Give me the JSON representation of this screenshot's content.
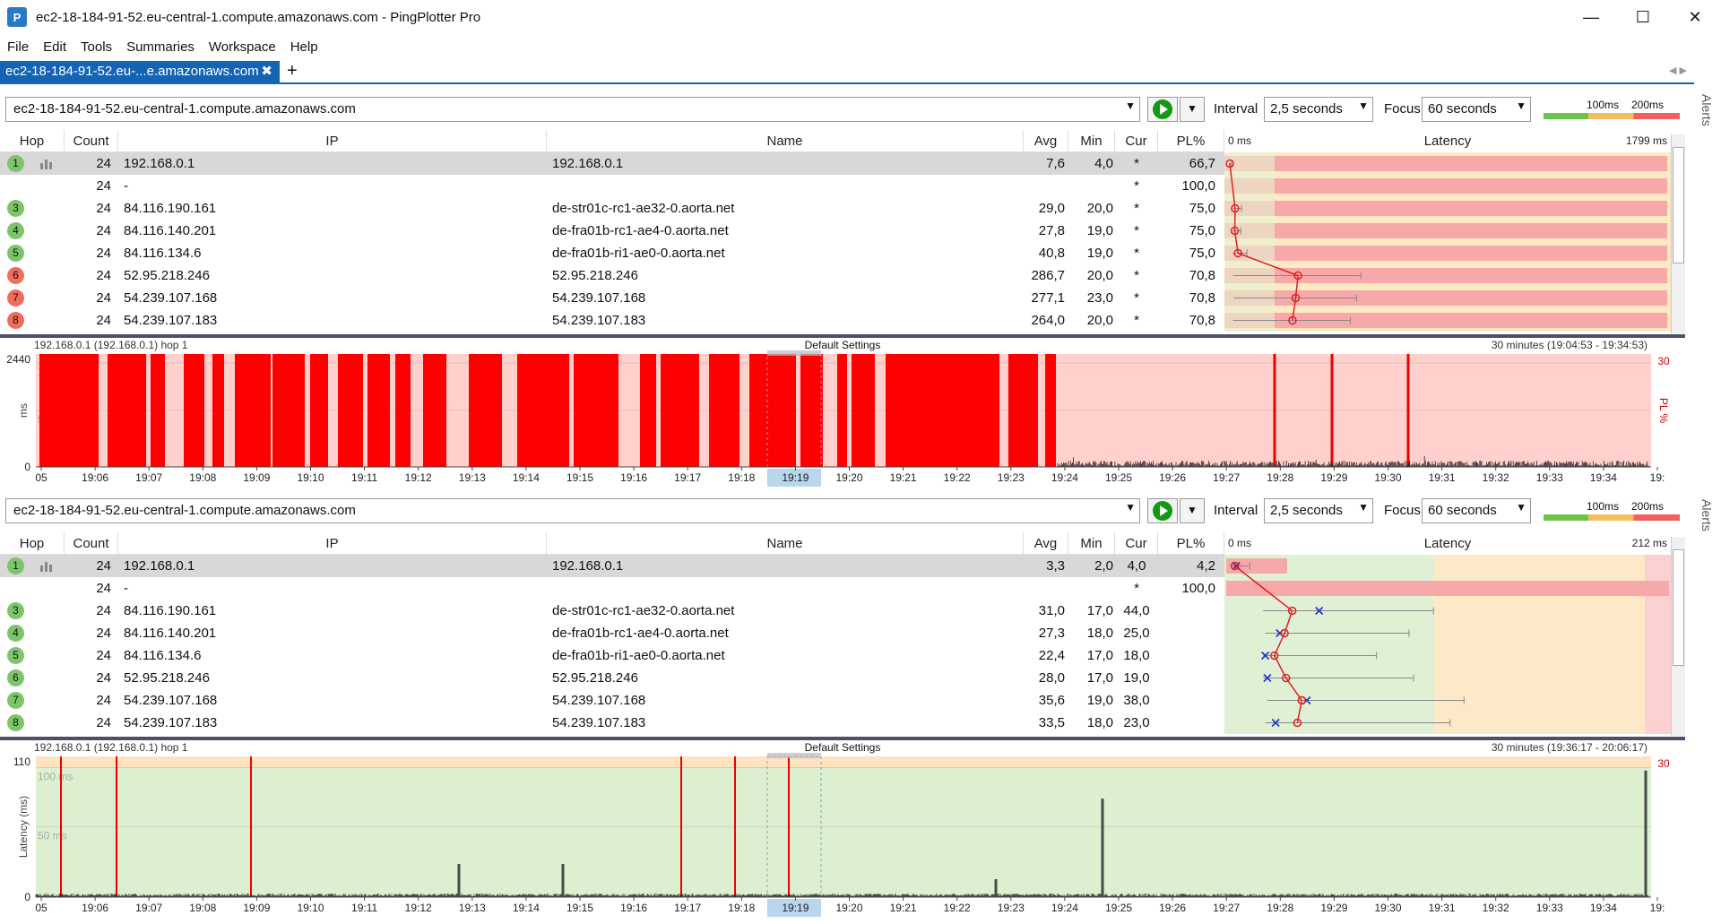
{
  "window": {
    "title": "ec2-18-184-91-52.eu-central-1.compute.amazonaws.com - PingPlotter Pro",
    "icon": "app-logo-icon",
    "minimize": "—",
    "maximize": "☐",
    "close": "✕"
  },
  "menu": [
    "File",
    "Edit",
    "Tools",
    "Summaries",
    "Workspace",
    "Help"
  ],
  "tab": {
    "label": "ec2-18-184-91-52.eu-...e.amazonaws.com",
    "close": "✖",
    "add": "+",
    "nav": "◀  ▶"
  },
  "alerts": "Alerts",
  "columns": {
    "hop": "Hop",
    "count": "Count",
    "ip": "IP",
    "name": "Name",
    "avg": "Avg",
    "min": "Min",
    "cur": "Cur",
    "pl": "PL%",
    "latency": "Latency"
  },
  "panels": [
    {
      "target": "ec2-18-184-91-52.eu-central-1.compute.amazonaws.com",
      "interval_label": "Interval",
      "interval": "2,5 seconds",
      "focus_label": "Focus",
      "focus": "60 seconds",
      "scale_100": "100ms",
      "scale_200": "200ms",
      "lat_min": "0 ms",
      "lat_max": "1799 ms",
      "rows": [
        {
          "hop": "1",
          "status": "green",
          "count": "24",
          "ip": "192.168.0.1",
          "name": "192.168.0.1",
          "avg": "7,6",
          "min": "4,0",
          "cur": "*",
          "pl": "66,7"
        },
        {
          "hop": "",
          "status": "none",
          "count": "24",
          "ip": "-",
          "name": "",
          "avg": "",
          "min": "",
          "cur": "*",
          "pl": "100,0"
        },
        {
          "hop": "3",
          "status": "green",
          "count": "24",
          "ip": "84.116.190.161",
          "name": "de-str01c-rc1-ae32-0.aorta.net",
          "avg": "29,0",
          "min": "20,0",
          "cur": "*",
          "pl": "75,0"
        },
        {
          "hop": "4",
          "status": "green",
          "count": "24",
          "ip": "84.116.140.201",
          "name": "de-fra01b-rc1-ae4-0.aorta.net",
          "avg": "27,8",
          "min": "19,0",
          "cur": "*",
          "pl": "75,0"
        },
        {
          "hop": "5",
          "status": "green",
          "count": "24",
          "ip": "84.116.134.6",
          "name": "de-fra01b-ri1-ae0-0.aorta.net",
          "avg": "40,8",
          "min": "19,0",
          "cur": "*",
          "pl": "75,0"
        },
        {
          "hop": "6",
          "status": "red",
          "count": "24",
          "ip": "52.95.218.246",
          "name": "52.95.218.246",
          "avg": "286,7",
          "min": "20,0",
          "cur": "*",
          "pl": "70,8"
        },
        {
          "hop": "7",
          "status": "red",
          "count": "24",
          "ip": "54.239.107.168",
          "name": "54.239.107.168",
          "avg": "277,1",
          "min": "23,0",
          "cur": "*",
          "pl": "70,8"
        },
        {
          "hop": "8",
          "status": "red",
          "count": "24",
          "ip": "54.239.107.183",
          "name": "54.239.107.183",
          "avg": "264,0",
          "min": "20,0",
          "cur": "*",
          "pl": "70,8"
        }
      ],
      "graph": {
        "header": "192.168.0.1 (192.168.0.1) hop 1",
        "center": "Default Settings",
        "range": "30 minutes (19:04:53 - 19:34:53)",
        "ymax": "2440",
        "ymin": "0",
        "yunit": "ms",
        "pl_label": "PL %",
        "pl_max": "30",
        "grid1": "1000 ms",
        "grid2": "500 ms"
      }
    },
    {
      "target": "ec2-18-184-91-52.eu-central-1.compute.amazonaws.com",
      "interval_label": "Interval",
      "interval": "2,5 seconds",
      "focus_label": "Focus",
      "focus": "60 seconds",
      "scale_100": "100ms",
      "scale_200": "200ms",
      "lat_min": "0 ms",
      "lat_max": "212 ms",
      "rows": [
        {
          "hop": "1",
          "status": "green",
          "count": "24",
          "ip": "192.168.0.1",
          "name": "192.168.0.1",
          "avg": "3,3",
          "min": "2,0",
          "cur": "4,0",
          "pl": "4,2"
        },
        {
          "hop": "",
          "status": "none",
          "count": "24",
          "ip": "-",
          "name": "",
          "avg": "",
          "min": "",
          "cur": "*",
          "pl": "100,0"
        },
        {
          "hop": "3",
          "status": "green",
          "count": "24",
          "ip": "84.116.190.161",
          "name": "de-str01c-rc1-ae32-0.aorta.net",
          "avg": "31,0",
          "min": "17,0",
          "cur": "44,0",
          "pl": ""
        },
        {
          "hop": "4",
          "status": "green",
          "count": "24",
          "ip": "84.116.140.201",
          "name": "de-fra01b-rc1-ae4-0.aorta.net",
          "avg": "27,3",
          "min": "18,0",
          "cur": "25,0",
          "pl": ""
        },
        {
          "hop": "5",
          "status": "green",
          "count": "24",
          "ip": "84.116.134.6",
          "name": "de-fra01b-ri1-ae0-0.aorta.net",
          "avg": "22,4",
          "min": "17,0",
          "cur": "18,0",
          "pl": ""
        },
        {
          "hop": "6",
          "status": "green",
          "count": "24",
          "ip": "52.95.218.246",
          "name": "52.95.218.246",
          "avg": "28,0",
          "min": "17,0",
          "cur": "19,0",
          "pl": ""
        },
        {
          "hop": "7",
          "status": "green",
          "count": "24",
          "ip": "54.239.107.168",
          "name": "54.239.107.168",
          "avg": "35,6",
          "min": "19,0",
          "cur": "38,0",
          "pl": ""
        },
        {
          "hop": "8",
          "status": "green",
          "count": "24",
          "ip": "54.239.107.183",
          "name": "54.239.107.183",
          "avg": "33,5",
          "min": "18,0",
          "cur": "23,0",
          "pl": ""
        }
      ],
      "graph": {
        "header": "192.168.0.1 (192.168.0.1) hop 1",
        "center": "Default Settings",
        "range": "30 minutes (19:36:17 - 20:06:17)",
        "ymax": "110",
        "ymin": "0",
        "yunit": "Latency (ms)",
        "pl_label": "",
        "pl_max": "30",
        "grid1": "100 ms",
        "grid2": "50 ms"
      }
    }
  ],
  "time_ticks": [
    "05",
    "19:06",
    "19:07",
    "19:08",
    "19:09",
    "19:10",
    "19:11",
    "19:12",
    "19:13",
    "19:14",
    "19:15",
    "19:16",
    "19:17",
    "19:18",
    "19:19",
    "19:20",
    "19:21",
    "19:22",
    "19:23",
    "19:24",
    "19:25",
    "19:26",
    "19:27",
    "19:28",
    "19:29",
    "19:30",
    "19:31",
    "19:32",
    "19:33",
    "19:34",
    "19:"
  ],
  "colors": {
    "accent": "#1464b4",
    "good": "#7cc56a",
    "bad": "#f06c5c",
    "loss": "#ff0000"
  }
}
